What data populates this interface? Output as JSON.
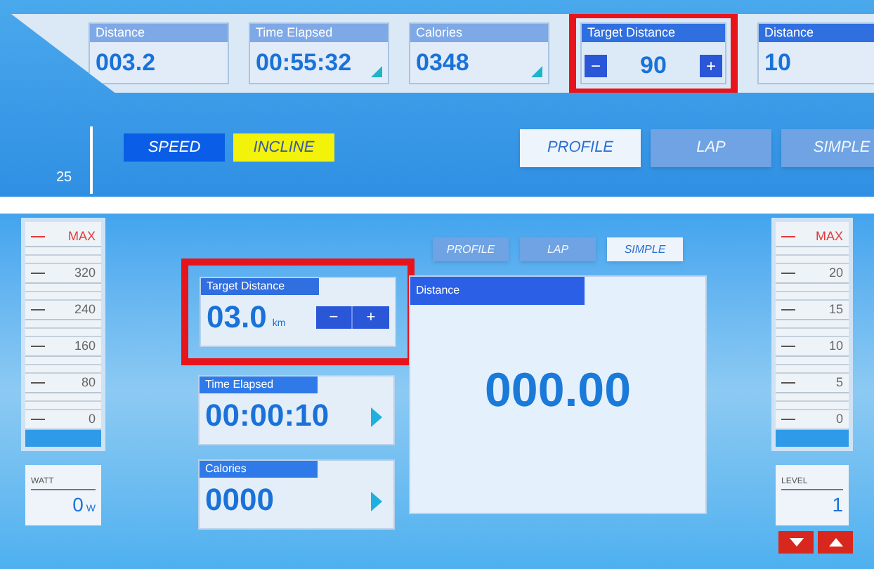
{
  "top": {
    "stats": [
      {
        "kind": "stat",
        "label": "Distance",
        "value": "003.2",
        "corner": false,
        "highlighted": false
      },
      {
        "kind": "stat",
        "label": "Time Elapsed",
        "value": "00:55:32",
        "corner": true,
        "highlighted": false
      },
      {
        "kind": "stat",
        "label": "Calories",
        "value": "0348",
        "corner": true,
        "highlighted": false
      },
      {
        "kind": "stepper",
        "label": "Target Distance",
        "value": "90",
        "minus": "−",
        "plus": "+",
        "highlighted": true
      },
      {
        "kind": "stat",
        "label": "Distance",
        "value": "10",
        "corner": false,
        "highlighted": false
      }
    ],
    "modes": [
      {
        "label": "SPEED",
        "color": "#0a5de6"
      },
      {
        "label": "INCLINE",
        "color": "#f2f20a"
      }
    ],
    "views": [
      {
        "label": "PROFILE",
        "selected": true
      },
      {
        "label": "LAP",
        "selected": false
      },
      {
        "label": "SIMPLE",
        "selected": false
      }
    ],
    "scale_label": "25"
  },
  "bottom": {
    "left_gauge": {
      "ticks": [
        "MAX",
        "320",
        "240",
        "160",
        "80",
        "0"
      ],
      "readout_label": "WATT",
      "readout_value": "0",
      "readout_unit": "W"
    },
    "views": [
      {
        "label": "PROFILE",
        "selected": false
      },
      {
        "label": "LAP",
        "selected": false
      },
      {
        "label": "SIMPLE",
        "selected": true
      }
    ],
    "target": {
      "label": "Target Distance",
      "value": "03.0",
      "unit": "km",
      "minus": "−",
      "plus": "+",
      "highlighted": true
    },
    "cards": [
      {
        "label": "Time Elapsed",
        "value": "00:00:10"
      },
      {
        "label": "Calories",
        "value": "0000"
      }
    ],
    "distance": {
      "label": "Distance",
      "value": "000.00"
    },
    "right_gauge": {
      "ticks": [
        "MAX",
        "20",
        "15",
        "10",
        "5",
        "0"
      ],
      "readout_label": "LEVEL",
      "readout_value": "1"
    },
    "arrows": [
      {
        "kind": "down"
      },
      {
        "kind": "up"
      }
    ]
  }
}
